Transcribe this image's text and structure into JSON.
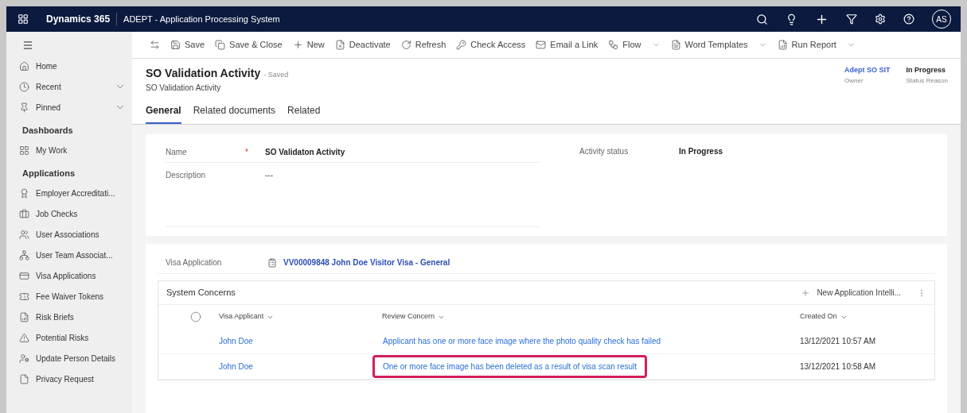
{
  "topbar": {
    "app": "Dynamics 365",
    "title": "ADEPT - Application Processing System",
    "avatar": "AS"
  },
  "sidebar": {
    "items": [
      {
        "label": "Home",
        "kind": "home",
        "chevron": false
      },
      {
        "label": "Recent",
        "kind": "recent",
        "chevron": true
      },
      {
        "label": "Pinned",
        "kind": "pin",
        "chevron": true
      }
    ],
    "sections": [
      {
        "title": "Dashboards",
        "items": [
          {
            "label": "My Work",
            "kind": "work"
          }
        ]
      },
      {
        "title": "Applications",
        "items": [
          {
            "label": "Employer Accreditati...",
            "kind": "accred"
          },
          {
            "label": "Job Checks",
            "kind": "job"
          },
          {
            "label": "User Associations",
            "kind": "users"
          },
          {
            "label": "User Team Associat...",
            "kind": "team"
          },
          {
            "label": "Visa Applications",
            "kind": "visa"
          },
          {
            "label": "Fee Waiver Tokens",
            "kind": "fee"
          },
          {
            "label": "Risk Briefs",
            "kind": "risk"
          },
          {
            "label": "Potential Risks",
            "kind": "warn"
          },
          {
            "label": "Update Person Details",
            "kind": "person"
          },
          {
            "label": "Privacy Request",
            "kind": "doc"
          }
        ]
      }
    ]
  },
  "commands": [
    {
      "label": "Save",
      "kind": "save",
      "menu": false
    },
    {
      "label": "Save & Close",
      "kind": "saveclose",
      "menu": false
    },
    {
      "label": "New",
      "kind": "new",
      "menu": false
    },
    {
      "label": "Deactivate",
      "kind": "deactivate",
      "menu": false
    },
    {
      "label": "Refresh",
      "kind": "refresh",
      "menu": false
    },
    {
      "label": "Check Access",
      "kind": "access",
      "menu": false
    },
    {
      "label": "Email a Link",
      "kind": "email",
      "menu": false
    },
    {
      "label": "Flow",
      "kind": "flow",
      "menu": true
    },
    {
      "label": "Word Templates",
      "kind": "word",
      "menu": true
    },
    {
      "label": "Run Report",
      "kind": "report",
      "menu": true
    }
  ],
  "header": {
    "title": "SO Validation Activity",
    "save_state": "- Saved",
    "subtitle": "SO Validation Activity",
    "fields": [
      {
        "value": "Adept SO SIT",
        "label": "Owner",
        "link": true
      },
      {
        "value": "In Progress",
        "label": "Status Reason",
        "link": false
      }
    ]
  },
  "tabs": [
    {
      "label": "General",
      "selected": true
    },
    {
      "label": "Related documents",
      "selected": false
    },
    {
      "label": "Related",
      "selected": false
    }
  ],
  "form": {
    "name_label": "Name",
    "name_value": "SO Validaton Activity",
    "required_mark": "*",
    "description_label": "Description",
    "description_value": "---",
    "status_label": "Activity status",
    "status_value": "In Progress"
  },
  "visa": {
    "label": "Visa Application",
    "value": "VV00009848 John Doe Visitor Visa - General"
  },
  "grid": {
    "title": "System Concerns",
    "all_checked": false,
    "new_label": "New Application Intelli...",
    "columns": [
      "Visa Applicant",
      "Review Concern",
      "Created On"
    ],
    "rows": [
      {
        "applicant": "John Doe",
        "concern": "Applicant has one or more face image where the photo quality check has failed",
        "created": "13/12/2021 10:57 AM",
        "highlighted": false
      },
      {
        "applicant": "John Doe",
        "concern": "One or more face image has been deleted as a result of visa scan result",
        "created": "13/12/2021 10:58 AM",
        "highlighted": true
      }
    ]
  }
}
